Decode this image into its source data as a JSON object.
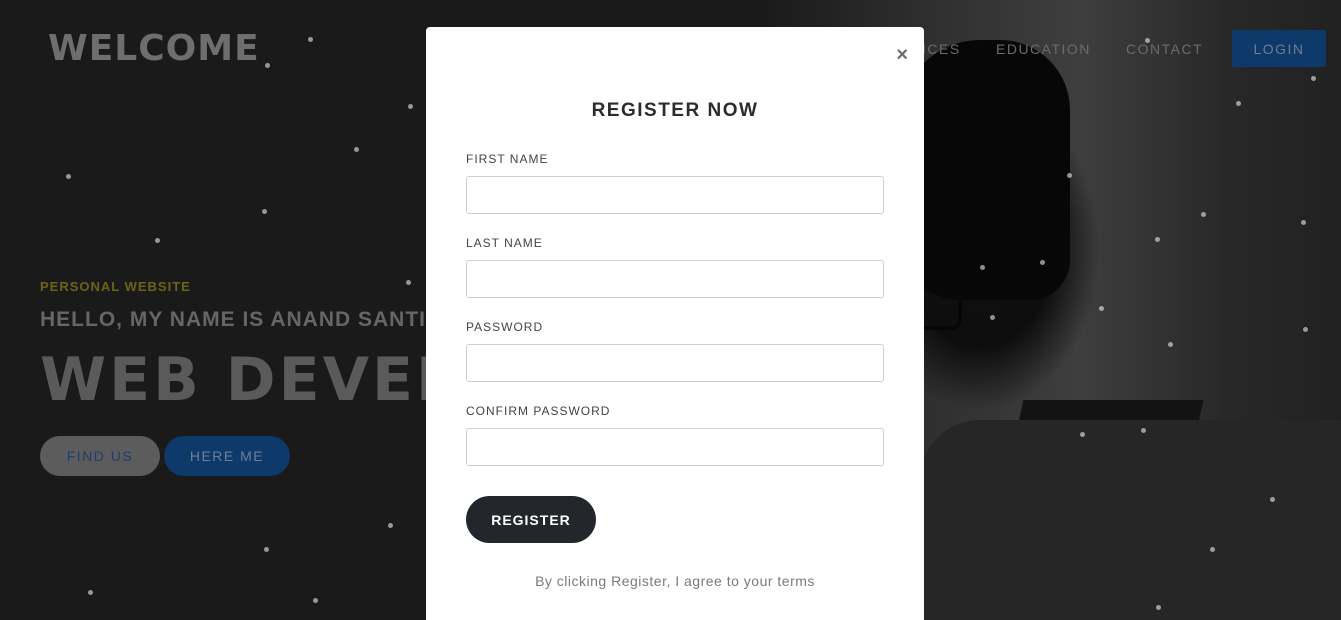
{
  "header": {
    "brand": "WELCOME",
    "nav": [
      "ICES",
      "EDUCATION",
      "CONTACT"
    ],
    "login_label": "LOGIN"
  },
  "hero": {
    "subtitle": "PERSONAL WEBSITE",
    "name_line": "HELLO, MY NAME IS ANAND SANTI",
    "title": "WEB DEVELO",
    "buttons": {
      "find_us": "FIND US",
      "here_me": "HERE ME"
    }
  },
  "modal": {
    "close_icon": "×",
    "title": "REGISTER NOW",
    "fields": [
      {
        "label": "FIRST NAME",
        "value": ""
      },
      {
        "label": "LAST NAME",
        "value": ""
      },
      {
        "label": "PASSWORD",
        "value": ""
      },
      {
        "label": "CONFIRM PASSWORD",
        "value": ""
      }
    ],
    "register_label": "REGISTER",
    "terms": "By clicking Register, I agree to your terms"
  }
}
